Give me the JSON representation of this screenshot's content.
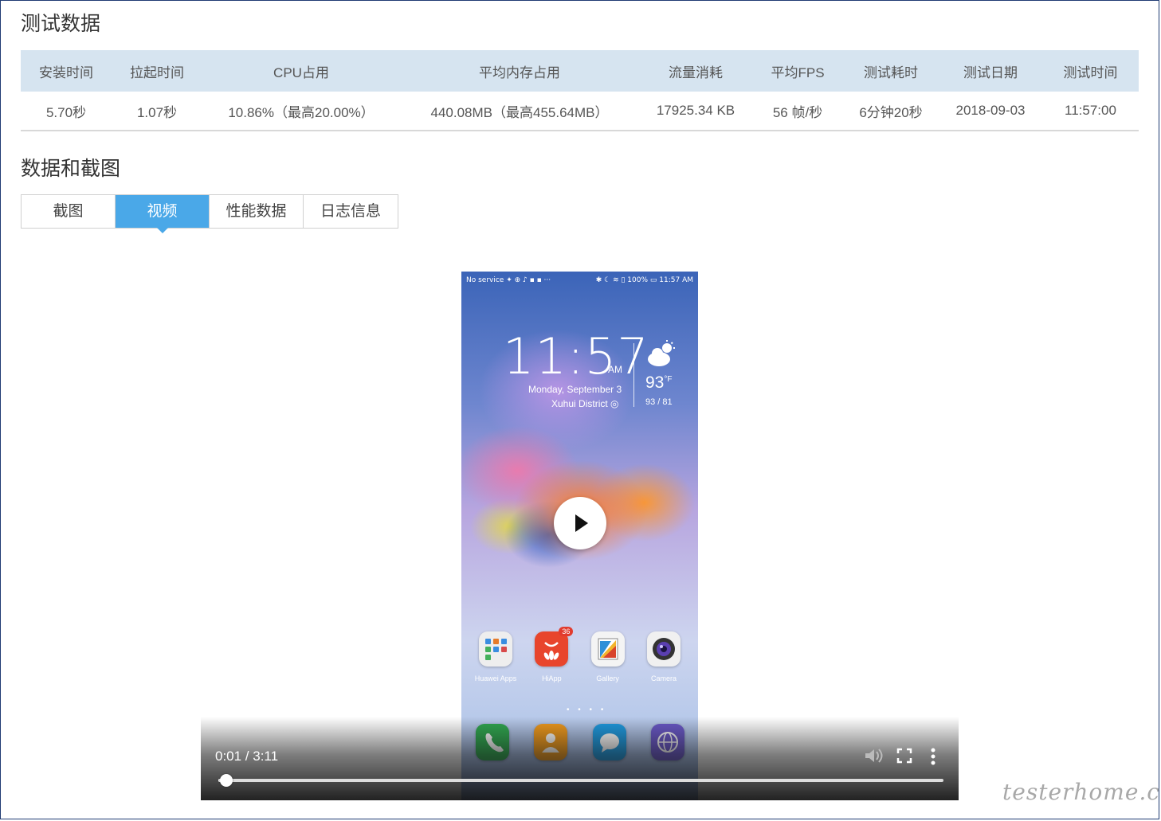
{
  "sections": {
    "test_data_title": "测试数据",
    "data_screens_title": "数据和截图"
  },
  "stats_table": {
    "headers": [
      "安装时间",
      "拉起时间",
      "CPU占用",
      "平均内存占用",
      "流量消耗",
      "平均FPS",
      "测试耗时",
      "测试日期",
      "测试时间"
    ],
    "row": [
      "5.70秒",
      "1.07秒",
      "10.86%（最高20.00%）",
      "440.08MB（最高455.64MB）",
      "17925.34 KB",
      "56 帧/秒",
      "6分钟20秒",
      "2018-09-03",
      "11:57:00"
    ]
  },
  "tabs": [
    {
      "label": "截图",
      "active": false
    },
    {
      "label": "视频",
      "active": true
    },
    {
      "label": "性能数据",
      "active": false
    },
    {
      "label": "日志信息",
      "active": false
    }
  ],
  "video": {
    "time_display": "0:01 / 3:11",
    "progress_fraction": 0.011,
    "phone": {
      "status_left": "No service ✦ ⊕ ♪ ▪ ▪ ···",
      "status_right": "✱ ☾ ≋ ▯ 100% ▭ 11:57 AM",
      "clock": "11:57",
      "ampm": "AM",
      "date": "Monday, September 3",
      "location": "Xuhui District ◎",
      "temp": "93",
      "temp_unit": "°F",
      "temp_range": "93 / 81",
      "apps": [
        {
          "label": "Huawei Apps",
          "icon": "huawei-apps-icon",
          "color": "#eeeeee"
        },
        {
          "label": "HiApp",
          "icon": "hiapp-icon",
          "color": "#e8452c",
          "badge": "36"
        },
        {
          "label": "Gallery",
          "icon": "gallery-icon",
          "color": "#f4f4f4"
        },
        {
          "label": "Camera",
          "icon": "camera-icon",
          "color": "#f0f0f0"
        }
      ],
      "dock": [
        {
          "icon": "phone-icon",
          "color": "#2fa84f"
        },
        {
          "icon": "contacts-icon",
          "color": "#f09a1c"
        },
        {
          "icon": "messages-icon",
          "color": "#1e9ae0"
        },
        {
          "icon": "browser-icon",
          "color": "#6a58c8"
        }
      ],
      "page_dots": "• • • •"
    }
  },
  "watermark": "testerhome.com",
  "colors": {
    "header_bg": "#d6e4f0",
    "tab_active": "#4aa8e8"
  }
}
